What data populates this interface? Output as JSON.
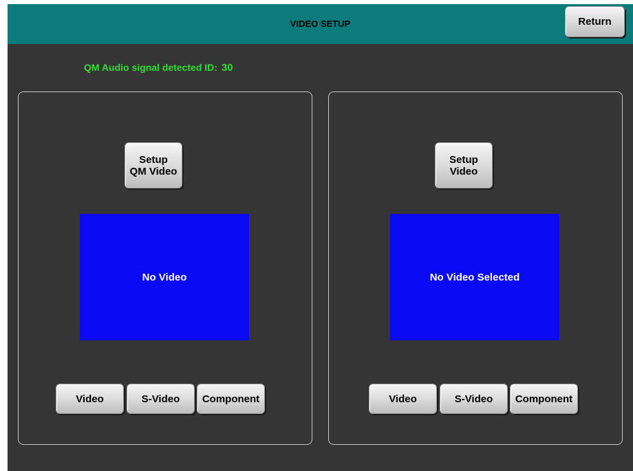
{
  "header": {
    "title": "VIDEO SETUP",
    "return_label": "Return"
  },
  "status": {
    "label": "QM Audio signal detected ID:",
    "id": "30"
  },
  "panels": [
    {
      "setup_label": "Setup\nQM Video",
      "display_text": "No Video",
      "sources": [
        "Video",
        "S-Video",
        "Component"
      ]
    },
    {
      "setup_label": "Setup\nVideo",
      "display_text": "No Video Selected",
      "sources": [
        "Video",
        "S-Video",
        "Component"
      ]
    }
  ],
  "colors": {
    "header_bg": "#0b7b7b",
    "screen_bg": "#353535",
    "display_bg": "#0a0af5",
    "status_text": "#33dd33"
  }
}
